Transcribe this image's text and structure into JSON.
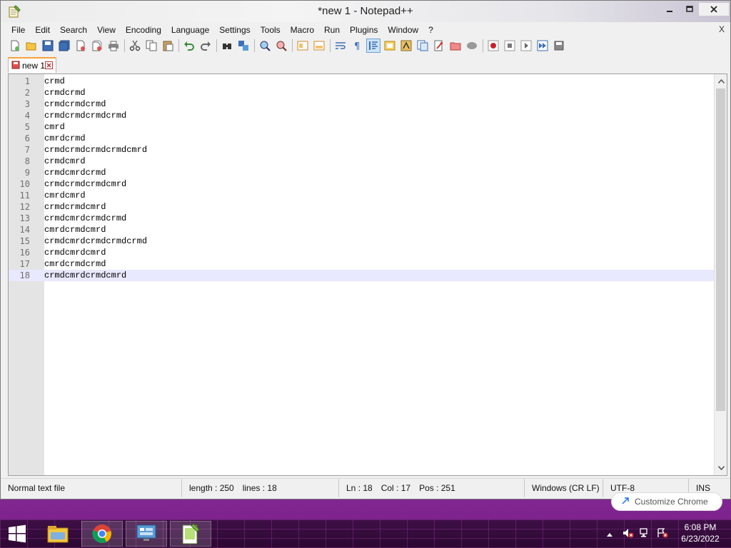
{
  "window": {
    "title": "*new 1 - Notepad++"
  },
  "menu": {
    "items": [
      "File",
      "Edit",
      "Search",
      "View",
      "Encoding",
      "Language",
      "Settings",
      "Tools",
      "Macro",
      "Run",
      "Plugins",
      "Window",
      "?"
    ],
    "close_label": "X"
  },
  "toolbar": {
    "buttons": [
      {
        "icon": "new-file-icon"
      },
      {
        "icon": "open-file-icon"
      },
      {
        "icon": "save-icon"
      },
      {
        "icon": "save-all-icon"
      },
      {
        "icon": "close-file-icon"
      },
      {
        "icon": "close-all-icon"
      },
      {
        "icon": "print-icon"
      },
      {
        "icon": "cut-icon"
      },
      {
        "icon": "copy-icon"
      },
      {
        "icon": "paste-icon"
      },
      {
        "icon": "undo-icon"
      },
      {
        "icon": "redo-icon"
      },
      {
        "icon": "find-icon"
      },
      {
        "icon": "replace-icon"
      },
      {
        "icon": "zoom-in-icon"
      },
      {
        "icon": "zoom-out-icon"
      },
      {
        "icon": "sync-vertical-icon"
      },
      {
        "icon": "sync-horizontal-icon"
      },
      {
        "icon": "word-wrap-icon"
      },
      {
        "icon": "show-all-characters-icon"
      },
      {
        "icon": "indent-guide-icon",
        "active": true
      },
      {
        "icon": "define-language-icon"
      },
      {
        "icon": "document-map-icon"
      },
      {
        "icon": "function-list-icon"
      },
      {
        "icon": "folder-as-workspace-icon"
      },
      {
        "icon": "monitoring-icon"
      },
      {
        "icon": "panel-icon"
      },
      {
        "icon": "record-macro-icon"
      },
      {
        "icon": "stop-recording-icon"
      },
      {
        "icon": "playback-macro-icon"
      },
      {
        "icon": "run-macro-multiple-icon"
      },
      {
        "icon": "save-macro-icon"
      }
    ]
  },
  "tab": {
    "label": "new 1"
  },
  "editor": {
    "lines": [
      {
        "number": "1",
        "text": "crmd"
      },
      {
        "number": "2",
        "text": "crmdcrmd"
      },
      {
        "number": "3",
        "text": "crmdcrmdcrmd"
      },
      {
        "number": "4",
        "text": "crmdcrmdcrmdcrmd"
      },
      {
        "number": "5",
        "text": "cmrd"
      },
      {
        "number": "6",
        "text": "cmrdcrmd"
      },
      {
        "number": "7",
        "text": "crmdcrmdcrmdcrmdcmrd"
      },
      {
        "number": "8",
        "text": "crmdcmrd"
      },
      {
        "number": "9",
        "text": "crmdcmrdcrmd"
      },
      {
        "number": "10",
        "text": "crmdcrmdcrmdcmrd"
      },
      {
        "number": "11",
        "text": "cmrdcmrd"
      },
      {
        "number": "12",
        "text": "crmdcrmdcmrd"
      },
      {
        "number": "13",
        "text": "crmdcmrdcrmdcrmd"
      },
      {
        "number": "14",
        "text": "cmrdcrmdcmrd"
      },
      {
        "number": "15",
        "text": "crmdcmrdcrmdcrmdcrmd"
      },
      {
        "number": "16",
        "text": "crmdcmrdcmrd"
      },
      {
        "number": "17",
        "text": "cmrdcrmdcrmd"
      },
      {
        "number": "18",
        "text": "crmdcmrdcrmdcmrd"
      }
    ],
    "current_line": 18
  },
  "status": {
    "file_type": "Normal text file",
    "length": "length : 250",
    "lines": "lines : 18",
    "ln": "Ln : 18",
    "col": "Col : 17",
    "pos": "Pos : 251",
    "eol": "Windows (CR LF)",
    "encoding": "UTF-8",
    "mode": "INS"
  },
  "notification": {
    "text": "Customize Chrome"
  },
  "taskbar": {
    "apps": [
      {
        "icon": "file-explorer-icon"
      },
      {
        "icon": "chrome-icon"
      },
      {
        "icon": "control-panel-icon"
      },
      {
        "icon": "notepadpp-icon",
        "running": true
      }
    ],
    "clock_time": "6:08 PM",
    "clock_date": "6/23/2022"
  },
  "colors": {
    "tab_accent": "#f7a23a",
    "current_line": "#e8e8ff",
    "taskbar": "#3e0f46"
  }
}
